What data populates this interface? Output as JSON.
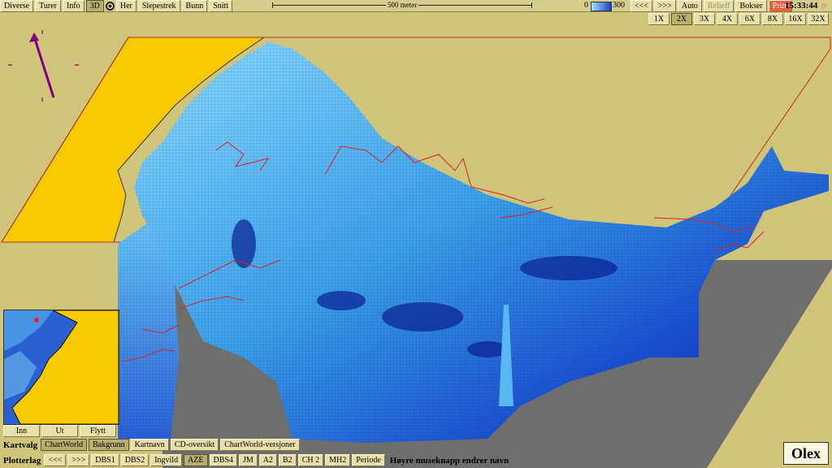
{
  "topbar": {
    "menu": [
      "Diverse",
      "Turer",
      "Info"
    ],
    "btn_3d": "3D",
    "menu2": [
      "Her",
      "Slepestrek",
      "Bunn",
      "Snitt"
    ],
    "scale_label": "500 meter",
    "depth_min": "0",
    "depth_max": "300",
    "nav": [
      "<<<",
      ">>>"
    ],
    "auto": "Auto",
    "relieff": "Relieff",
    "bokser": "Bokser",
    "print": "Print",
    "clock": "15:33:44"
  },
  "zoom": {
    "levels": [
      "1X",
      "2X",
      "3X",
      "4X",
      "6X",
      "8X",
      "16X",
      "32X"
    ],
    "selected": "2X"
  },
  "minimap_buttons": [
    "Inn",
    "Ut",
    "Flytt"
  ],
  "kartvalg": {
    "label": "Kartvalg",
    "items": [
      "ChartWorld",
      "Bakgrunn",
      "Kartnavn",
      "CD-oversikt",
      "ChartWorld-versjoner"
    ]
  },
  "plotterlag": {
    "label": "Plotterlag",
    "items": [
      "<<<",
      ">>>",
      "DBS1",
      "DBS2",
      "Ingvild",
      "AZE",
      "DBS4",
      "JM",
      "A2",
      "B2",
      "CH 2",
      "MH2",
      "Periode"
    ],
    "selected": "AZE"
  },
  "hint": "Høyre museknapp endrer navn",
  "logo": "Olex",
  "colors": {
    "background": "#cfc47a",
    "land": "#f8c800",
    "shallow": "#9fe2ff",
    "deep": "#1a40c8",
    "track": "#e02020",
    "compass": "#800080"
  }
}
